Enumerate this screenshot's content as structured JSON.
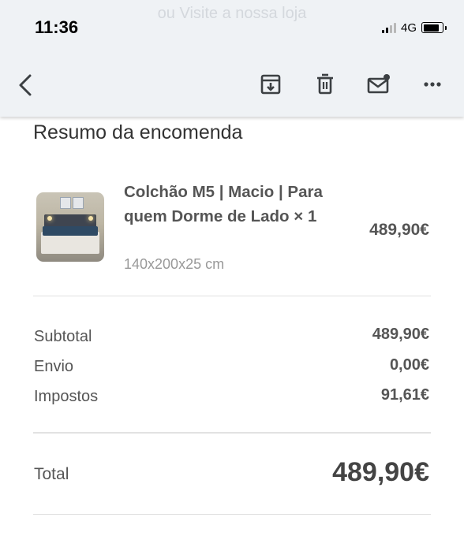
{
  "status_bar": {
    "time": "11:36",
    "network": "4G",
    "ghost_text": "ou Visite a nossa loja"
  },
  "toolbar": {
    "icons": [
      "chevron-left-icon",
      "archive-icon",
      "trash-icon",
      "mail-unread-icon",
      "more-icon"
    ]
  },
  "summary": {
    "title": "Resumo da encomenda",
    "product": {
      "name": "Colchão M5 | Macio | Para quem Dorme de Lado × 1",
      "variant": "140x200x25 cm",
      "price": "489,90€"
    },
    "rows": [
      {
        "label": "Subtotal",
        "value": "489,90€"
      },
      {
        "label": "Envio",
        "value": "0,00€"
      },
      {
        "label": "Impostos",
        "value": "91,61€"
      }
    ],
    "total": {
      "label": "Total",
      "value": "489,90€"
    }
  },
  "colors": {
    "toolbar_bg": "#eff2f5",
    "text": "#555555",
    "muted": "#999999"
  }
}
